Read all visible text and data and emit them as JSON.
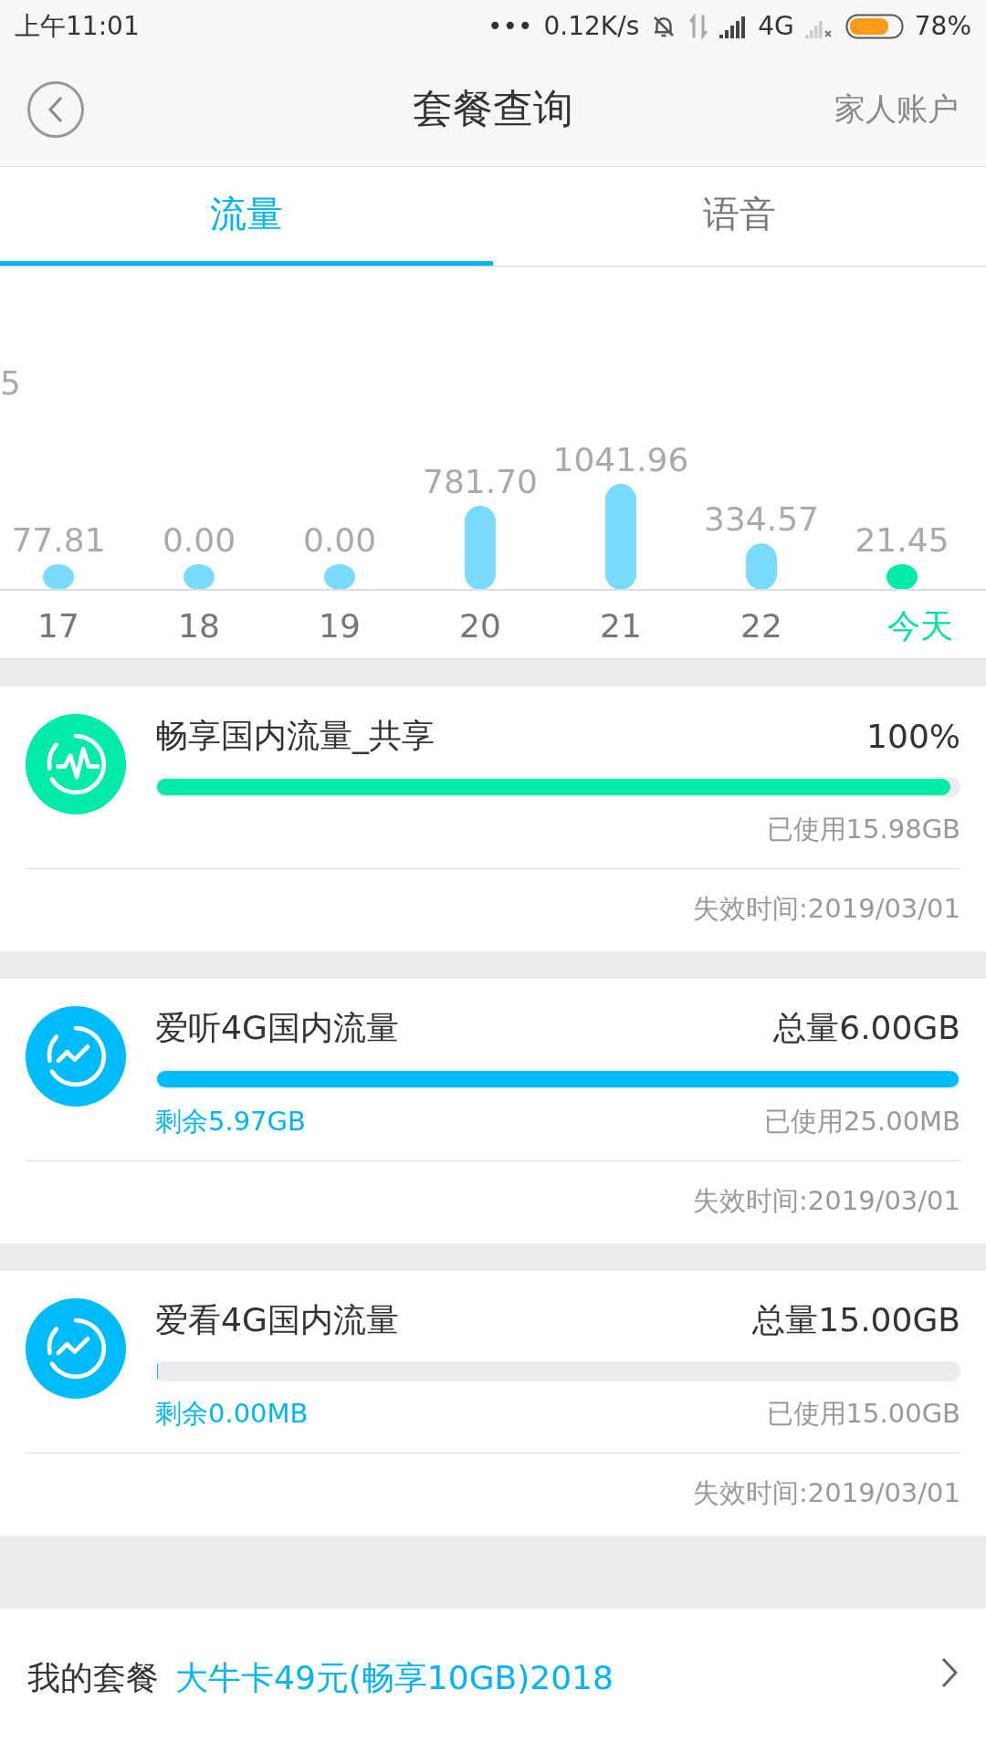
{
  "status_bar": {
    "time": "上午11:01",
    "dots": "•••",
    "speed": "0.12K/s",
    "network": "4G",
    "battery": "78%"
  },
  "header": {
    "title": "套餐查询",
    "action": "家人账户"
  },
  "tabs": [
    {
      "label": "流量",
      "selected": true
    },
    {
      "label": "语音",
      "selected": false
    }
  ],
  "usage_chart": {
    "cut_label": "5",
    "days": [
      {
        "day": "17",
        "usage": "77.81",
        "selected": false
      },
      {
        "day": "18",
        "usage": "0.00",
        "selected": false
      },
      {
        "day": "19",
        "usage": "0.00",
        "selected": false
      },
      {
        "day": "20",
        "usage": "781.70",
        "selected": false
      },
      {
        "day": "21",
        "usage": "1041.96",
        "selected": false
      },
      {
        "day": "22",
        "usage": "334.57",
        "selected": false
      },
      {
        "day": "今天",
        "usage": "21.45",
        "selected": true
      }
    ]
  },
  "packages": [
    {
      "kind": "pulse",
      "color": "#00eaa8",
      "name": "畅享国内流量_共享",
      "total": "100%",
      "level": 0.99,
      "used": "已使用15.98GB",
      "expires": "失效时间:2019/03/01"
    },
    {
      "kind": "trend",
      "color": "#00bbf9",
      "name": "爱听4G国内流量",
      "total": "总量6.00GB",
      "level": 1,
      "remaining": "剩余5.97GB",
      "used": "已使用25.00MB",
      "expires": "失效时间:2019/03/01"
    },
    {
      "kind": "trend",
      "color": "#00bbf9",
      "name": "爱看4G国内流量",
      "total": "总量15.00GB",
      "level": 0,
      "remaining": "剩余0.00MB",
      "used": "已使用15.00GB",
      "expires": "失效时间:2019/03/01"
    }
  ],
  "my_plan": {
    "label": "我的套餐",
    "value": "大牛卡49元(畅享10GB)2018"
  }
}
